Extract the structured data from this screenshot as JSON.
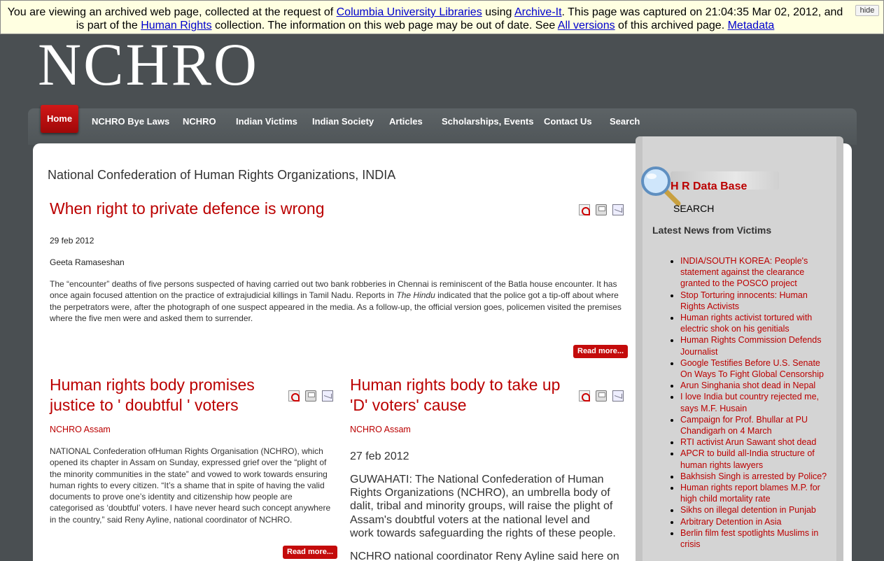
{
  "banner": {
    "t1": "You are viewing an archived web page, collected at the request of ",
    "link1": "Columbia University Libraries",
    "t2": " using ",
    "link2": "Archive-It",
    "t3": ". This page was captured on 21:04:35 Mar 02, 2012, and is part of the ",
    "link3": "Human Rights",
    "t4": " collection. The information on this web page may be out of date. See ",
    "link4": "All versions",
    "t5": " of this archived page. ",
    "link5": "Metadata",
    "hide": "hide"
  },
  "logo": "NCHRO",
  "nav": {
    "home": "Home",
    "items": [
      "NCHRO Bye Laws",
      "NCHRO",
      "Indian Victims",
      "Indian Society",
      "Articles",
      "Scholarships, Events",
      "Contact Us",
      "Search"
    ]
  },
  "site_title": "National Confederation of Human Rights Organizations, INDIA",
  "article1": {
    "title": "When right to private defence is wrong",
    "date": "29 feb 2012",
    "author": "Geeta Ramaseshan",
    "body_a": "The “encounter” deaths of five persons suspected of having carried out two bank robberies in Chennai is reminiscent of the Batla house encounter. It has once again focused attention on the practice of extrajudicial killings in Tamil Nadu. Reports in ",
    "body_em": "The Hindu",
    "body_b": " indicated that the police got a tip-off about where the perpetrators were, after the photograph of one suspect appeared in the media. As a follow-up, the official version goes, policemen visited the premises where the five men were and asked them to surrender.",
    "read_more": "Read more..."
  },
  "article2": {
    "title": "Human rights body promises justice to ' doubtful ' voters",
    "author": "NCHRO Assam",
    "body": "NATIONAL Confederation ofHuman Rights Organisation (NCHRO), which opened its chapter in Assam on Sunday, expressed grief over the “plight of the minority communities in the state” and vowed to work towards ensuring human rights to every citizen. “It’s a shame that in spite of having the valid documents to prove one’s identity and citizenship how people are categorised as ‘doubtful’ voters. I have never heard such concept anywhere in the country,” said Reny Ayline, national coordinator of NCHRO.",
    "read_more": "Read more..."
  },
  "article3": {
    "title": "Human rights body to take up 'D' voters' cause",
    "author": "NCHRO Assam",
    "date": "27 feb 2012",
    "body": "GUWAHATI: The National Confederation of Human Rights Organizations (NCHRO), an umbrella body of dalit, tribal and minority groups, will raise the plight of Assam's doubtful voters at the national level and work towards safeguarding the rights of these people.",
    "body2": "NCHRO national coordinator Reny Ayline said here on"
  },
  "sidebar": {
    "hr_title": "H R Data Base",
    "search": "SEARCH",
    "news_head": "Latest News from Victims",
    "news": [
      "INDIA/SOUTH KOREA: People's statement against the clearance granted to the POSCO project",
      "Stop Torturing innocents: Human Rights Activists",
      "Human rights activist tortured with electric shok on his genitials",
      "Human Rights Commission Defends Journalist",
      "Google Testifies Before U.S. Senate On Ways To Fight Global Censorship",
      "Arun Singhania shot dead in Nepal",
      "I love India but country rejected me, says M.F. Husain",
      "Campaign for Prof. Bhullar at PU Chandigarh on 4 March",
      "RTI activist Arun Sawant shot dead",
      "APCR to build all-India structure of human rights lawyers",
      "Bakhsish Singh is arrested by Police?",
      "Human rights report blames M.P. for high child mortality rate",
      "Sikhs on illegal detention in Punjab",
      "Arbitrary Detention in Asia",
      "Berlin film fest spotlights Muslims in crisis"
    ]
  },
  "colors": {
    "accent": "#bb0000",
    "background": "#4a4f52",
    "banner": "#ffffe1"
  },
  "icons": [
    "pdf-icon",
    "print-icon",
    "email-icon",
    "magnifier-icon"
  ]
}
